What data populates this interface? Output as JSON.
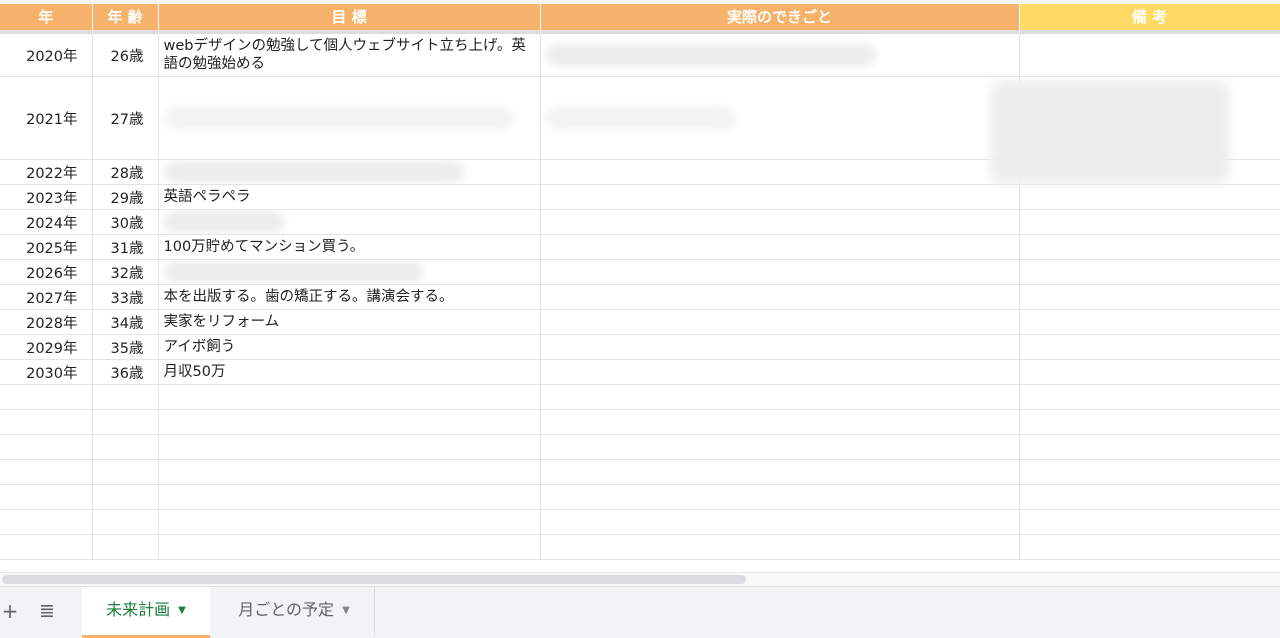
{
  "headers": {
    "year": "年",
    "age": "年 齢",
    "goal": "目 標",
    "actual": "実際のできごと",
    "note": "備 考"
  },
  "rows": [
    {
      "year": "2020年",
      "age": "26歳",
      "goal": "webデザインの勉強して個人ウェブサイト立ち上げ。英語の勉強始める"
    },
    {
      "year": "2021年",
      "age": "27歳",
      "goal": ""
    },
    {
      "year": "2022年",
      "age": "28歳",
      "goal": ""
    },
    {
      "year": "2023年",
      "age": "29歳",
      "goal": "英語ペラペラ"
    },
    {
      "year": "2024年",
      "age": "30歳",
      "goal": ""
    },
    {
      "year": "2025年",
      "age": "31歳",
      "goal": "100万貯めてマンション買う。"
    },
    {
      "year": "2026年",
      "age": "32歳",
      "goal": ""
    },
    {
      "year": "2027年",
      "age": "33歳",
      "goal": "本を出版する。歯の矯正する。講演会する。"
    },
    {
      "year": "2028年",
      "age": "34歳",
      "goal": "実家をリフォーム"
    },
    {
      "year": "2029年",
      "age": "35歳",
      "goal": "アイボ飼う"
    },
    {
      "year": "2030年",
      "age": "36歳",
      "goal": "月収50万"
    }
  ],
  "tabbar": {
    "add_icon": "+",
    "menu_icon": "≣",
    "tabs": [
      {
        "label": "未来計画",
        "active": true
      },
      {
        "label": "月ごとの予定",
        "active": false
      }
    ],
    "caret": "▼"
  },
  "colors": {
    "header_orange": "#f6b26b",
    "header_yellow": "#ffd966",
    "active_tab_text": "#188038"
  }
}
